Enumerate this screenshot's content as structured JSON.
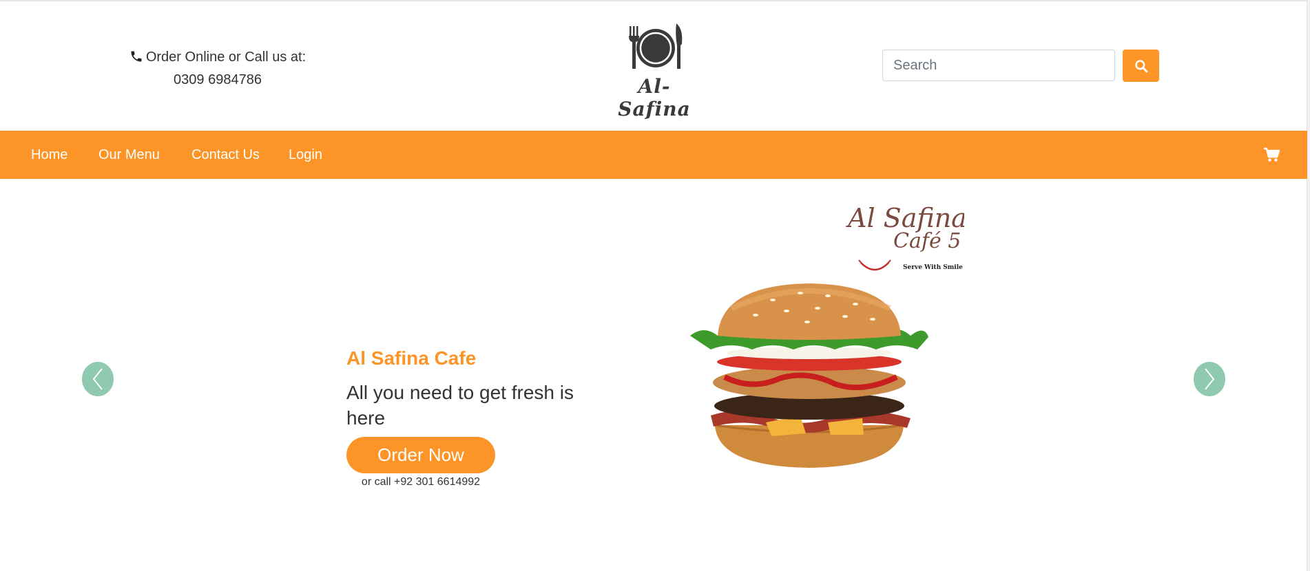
{
  "header": {
    "contact_line1": "Order Online or Call us at:",
    "contact_phone": "0309 6984786",
    "brand_name": "Al-Safina",
    "search_placeholder": "Search"
  },
  "nav": {
    "items": [
      {
        "label": "Home"
      },
      {
        "label": "Our Menu"
      },
      {
        "label": "Contact Us"
      },
      {
        "label": "Login"
      }
    ]
  },
  "hero": {
    "title": "Al Safina Cafe",
    "subtitle": "All you need to get fresh is here",
    "cta_label": "Order Now",
    "call_text": "or call +92 301 6614992",
    "promo_logo_line1": "Al Safina",
    "promo_logo_line2": "Café 5",
    "promo_tagline": "Serve With Smile"
  },
  "icons": {
    "phone": "phone-icon",
    "search": "search-icon",
    "cart": "shopping-cart-icon",
    "prev": "chevron-left-icon",
    "next": "chevron-right-icon",
    "brand_logo": "plate-fork-knife-icon"
  },
  "colors": {
    "accent": "#fd9427",
    "carousel_arrow": "#8ec9b0",
    "text": "#333333",
    "promo_brown": "#7a4a3e"
  }
}
